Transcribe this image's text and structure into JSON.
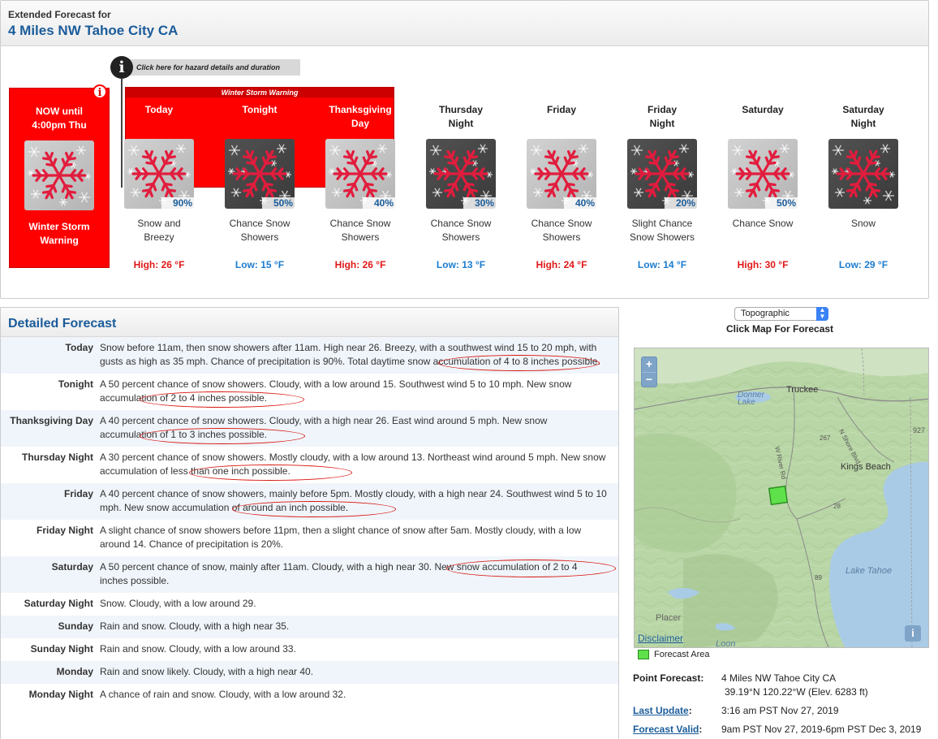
{
  "extended": {
    "label": "Extended Forecast for",
    "location": "4 Miles NW Tahoe City CA",
    "hazard_link": "Click here for hazard details and duration",
    "warning_band": "Winter Storm Warning",
    "now": {
      "label": "NOW until\n4:00pm Thu",
      "hazard": "Winter Storm\nWarning"
    },
    "periods": [
      {
        "name": "Today",
        "pop": "90%",
        "desc": "Snow and\nBreezy",
        "temp": "High: 26 °F",
        "kind": "high",
        "night": false,
        "warning": true
      },
      {
        "name": "Tonight",
        "pop": "50%",
        "desc": "Chance Snow\nShowers",
        "temp": "Low: 15 °F",
        "kind": "low",
        "night": true,
        "warning": true
      },
      {
        "name": "Thanksgiving\nDay",
        "pop": "40%",
        "desc": "Chance Snow\nShowers",
        "temp": "High: 26 °F",
        "kind": "high",
        "night": false,
        "warning": true
      },
      {
        "name": "Thursday\nNight",
        "pop": "30%",
        "desc": "Chance Snow\nShowers",
        "temp": "Low: 13 °F",
        "kind": "low",
        "night": true,
        "warning": false
      },
      {
        "name": "Friday",
        "pop": "40%",
        "desc": "Chance Snow\nShowers",
        "temp": "High: 24 °F",
        "kind": "high",
        "night": false,
        "warning": false
      },
      {
        "name": "Friday\nNight",
        "pop": "20%",
        "desc": "Slight Chance\nSnow Showers",
        "temp": "Low: 14 °F",
        "kind": "low",
        "night": true,
        "warning": false
      },
      {
        "name": "Saturday",
        "pop": "50%",
        "desc": "Chance Snow",
        "temp": "High: 30 °F",
        "kind": "high",
        "night": false,
        "warning": false
      },
      {
        "name": "Saturday\nNight",
        "pop": "",
        "desc": "Snow",
        "temp": "Low: 29 °F",
        "kind": "low",
        "night": true,
        "warning": false
      }
    ]
  },
  "detailed": {
    "title": "Detailed Forecast",
    "rows": [
      {
        "label": "Today",
        "text": "Snow before 11am, then snow showers after 11am. High near 26. Breezy, with a southwest wind 15 to 20 mph, with gusts as high as 35 mph. Chance of precipitation is 90%. Total daytime snow accumulation of 4 to 8 inches possible."
      },
      {
        "label": "Tonight",
        "text": "A 50 percent chance of snow showers. Cloudy, with a low around 15. Southwest wind 5 to 10 mph. New snow accumulation of 2 to 4 inches possible."
      },
      {
        "label": "Thanksgiving Day",
        "text": "A 40 percent chance of snow showers. Cloudy, with a high near 26. East wind around 5 mph. New snow accumulation of 1 to 3 inches possible."
      },
      {
        "label": "Thursday Night",
        "text": "A 30 percent chance of snow showers. Mostly cloudy, with a low around 13. Northeast wind around 5 mph. New snow accumulation of less than one inch possible."
      },
      {
        "label": "Friday",
        "text": "A 40 percent chance of snow showers, mainly before 5pm. Mostly cloudy, with a high near 24. Southwest wind 5 to 10 mph. New snow accumulation of around an inch possible."
      },
      {
        "label": "Friday Night",
        "text": "A slight chance of snow showers before 11pm, then a slight chance of snow after 5am. Mostly cloudy, with a low around 14. Chance of precipitation is 20%."
      },
      {
        "label": "Saturday",
        "text": "A 50 percent chance of snow, mainly after 11am. Cloudy, with a high near 30. New snow accumulation of 2 to 4 inches possible."
      },
      {
        "label": "Saturday Night",
        "text": "Snow. Cloudy, with a low around 29."
      },
      {
        "label": "Sunday",
        "text": "Rain and snow. Cloudy, with a high near 35."
      },
      {
        "label": "Sunday Night",
        "text": "Rain and snow. Cloudy, with a low around 33."
      },
      {
        "label": "Monday",
        "text": "Rain and snow likely. Cloudy, with a high near 40."
      },
      {
        "label": "Monday Night",
        "text": "A chance of rain and snow. Cloudy, with a low around 32."
      }
    ]
  },
  "map": {
    "type_selected": "Topographic",
    "caption": "Click Map For Forecast",
    "zoom_in": "+",
    "zoom_out": "−",
    "info": "i",
    "disclaimer": "Disclaimer",
    "labels": {
      "truckee": "Truckee",
      "donner_lake": "Donner\nLake",
      "kings_beach": "Kings Beach",
      "lake_tahoe": "Lake Tahoe",
      "placer": "Placer",
      "loon": "Loon",
      "n_shore_blvd": "N Shore Blvd",
      "w_river_rd": "W River Rd",
      "r89": "89",
      "r28": "28",
      "r267": "267",
      "r927": "927"
    },
    "colors": {
      "land": "#b9d6a6",
      "water": "#a9cbe6",
      "forecast_area": "#5ee14a"
    }
  },
  "legend": {
    "label": "Forecast Area"
  },
  "point": {
    "forecast_label": "Point Forecast:",
    "forecast_value": "4 Miles NW Tahoe City CA",
    "coords": "39.19°N 120.22°W (Elev. 6283 ft)",
    "update_label": "Last Update",
    "update_colon": ":",
    "update_value": "3:16 am PST Nov 27, 2019",
    "valid_label": "Forecast Valid",
    "valid_colon": ":",
    "valid_value": "9am PST Nov 27, 2019-6pm PST Dec 3, 2019"
  }
}
